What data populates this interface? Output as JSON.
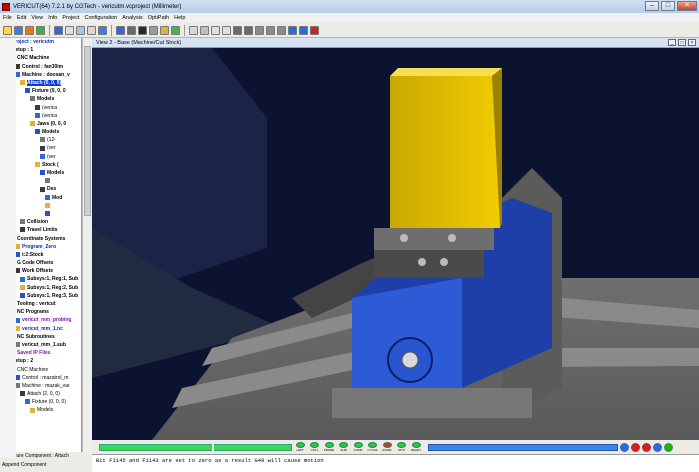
{
  "window": {
    "title": "VERICUT(64)  7.2.1 by CGTech - vericutm.vcproject (Millimeter)",
    "controls": [
      "–",
      "□",
      "✕"
    ]
  },
  "menu": [
    "File",
    "Edit",
    "View",
    "Info",
    "Project",
    "Configuration",
    "Analysis",
    "OptiPath",
    "Help"
  ],
  "tree": [
    {
      "t": "project : vericutm",
      "d": 0,
      "c": "blue"
    },
    {
      "t": "Setup : 1",
      "d": 0,
      "c": "bold"
    },
    {
      "t": "CNC Machine",
      "d": 1,
      "c": "bold"
    },
    {
      "t": "Control : fan30im",
      "d": 2,
      "c": "bold"
    },
    {
      "t": "Machine : doosan_v",
      "d": 2,
      "c": "bold"
    },
    {
      "t": "Attach (0, 0, 0)",
      "d": 3,
      "c": "sel"
    },
    {
      "t": "Fixture (0, 0, 0",
      "d": 4,
      "c": "bold"
    },
    {
      "t": "Models",
      "d": 5,
      "c": "bold"
    },
    {
      "t": "(verica",
      "d": 6,
      "c": ""
    },
    {
      "t": "(verica",
      "d": 6,
      "c": ""
    },
    {
      "t": "Jaws (0, 0, 0",
      "d": 5,
      "c": "bold"
    },
    {
      "t": "Models",
      "d": 6,
      "c": "bold"
    },
    {
      "t": "(12-",
      "d": 7,
      "c": ""
    },
    {
      "t": "(ver",
      "d": 7,
      "c": ""
    },
    {
      "t": "(ver",
      "d": 7,
      "c": ""
    },
    {
      "t": "Stock (",
      "d": 6,
      "c": "bold"
    },
    {
      "t": "Models",
      "d": 7,
      "c": "bold"
    },
    {
      "t": "",
      "d": 8,
      "c": ""
    },
    {
      "t": "Des",
      "d": 7,
      "c": "bold"
    },
    {
      "t": "Mod",
      "d": 8,
      "c": "bold"
    },
    {
      "t": "",
      "d": 8,
      "c": ""
    },
    {
      "t": "",
      "d": 8,
      "c": ""
    },
    {
      "t": "Collision",
      "d": 3,
      "c": "bold"
    },
    {
      "t": "Travel Limits",
      "d": 3,
      "c": "bold"
    },
    {
      "t": "Coordinate Systems",
      "d": 1,
      "c": "bold"
    },
    {
      "t": "Program_Zero",
      "d": 2,
      "c": "blue"
    },
    {
      "t": "t:2:Stock",
      "d": 2,
      "c": "bold"
    },
    {
      "t": "G Code Offsets",
      "d": 1,
      "c": "bold"
    },
    {
      "t": "Work Offsets",
      "d": 2,
      "c": "bold"
    },
    {
      "t": "Subsys:1, Reg:1, Sub",
      "d": 3,
      "c": "bold"
    },
    {
      "t": "Subsys:1, Reg:2, Sub",
      "d": 3,
      "c": "bold"
    },
    {
      "t": "Subsys:1, Reg:3, Sub",
      "d": 3,
      "c": "bold"
    },
    {
      "t": "Tooling : vericut",
      "d": 1,
      "c": "bold"
    },
    {
      "t": "NC Programs",
      "d": 1,
      "c": "bold"
    },
    {
      "t": "vericut_mm_probing",
      "d": 2,
      "c": "purple"
    },
    {
      "t": "vericut_mm_1.nc",
      "d": 2,
      "c": "blue"
    },
    {
      "t": "NC Subroutines",
      "d": 1,
      "c": "bold"
    },
    {
      "t": "vericut_mm_1.sub",
      "d": 2,
      "c": "bold"
    },
    {
      "t": "Saved IP Files",
      "d": 1,
      "c": "purple"
    },
    {
      "t": "Setup : 2",
      "d": 0,
      "c": "bold"
    },
    {
      "t": "CNC Machine",
      "d": 1,
      "c": ""
    },
    {
      "t": "Control : mazatrol_m",
      "d": 2,
      "c": ""
    },
    {
      "t": "Machine : mazak_var",
      "d": 2,
      "c": ""
    },
    {
      "t": "Attach (2, 0, 0)",
      "d": 3,
      "c": ""
    },
    {
      "t": "Fixture (0, 0, 0)",
      "d": 4,
      "c": ""
    },
    {
      "t": "Models",
      "d": 5,
      "c": ""
    }
  ],
  "status": {
    "line1": "Configure Component : Attach",
    "line2": "Append Component"
  },
  "view": {
    "title": "View 2 - Base (Machine/Cut Stock)"
  },
  "leds": [
    "LIMIT",
    "COLL",
    "PROBE",
    "SUB",
    "COMP",
    "CYCLE",
    "RAPID",
    "OPTI",
    "READY"
  ],
  "led_colors": [
    "#39c23b",
    "#39c23b",
    "#39c23b",
    "#39c23b",
    "#39c23b",
    "#39c23b",
    "#d83030",
    "#39c23b",
    "#39c23b"
  ],
  "progress": {
    "fraction": 0.58
  },
  "message": "Bit F1145 and F1143 are set to zero as a result G49 will cause motion"
}
